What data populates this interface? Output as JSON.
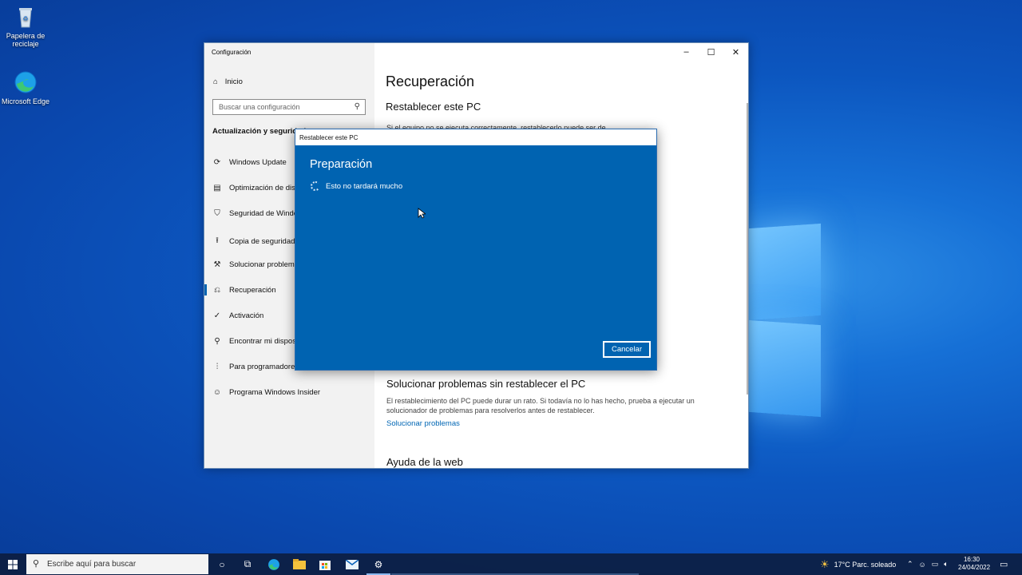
{
  "desktop": {
    "icons": [
      {
        "label": "Papelera de reciclaje"
      },
      {
        "label": "Microsoft Edge"
      }
    ]
  },
  "settings": {
    "window_title": "Configuración",
    "home_label": "Inicio",
    "search_placeholder": "Buscar una configuración",
    "section_heading": "Actualización y seguridad",
    "nav": [
      {
        "label": "Windows Update",
        "icon": "sync-icon"
      },
      {
        "label": "Optimización de distribución",
        "icon": "delivery-icon"
      },
      {
        "label": "Seguridad de Windows",
        "icon": "shield-icon"
      },
      {
        "label": "Copia de seguridad",
        "icon": "backup-arrow-icon"
      },
      {
        "label": "Solucionar problemas",
        "icon": "wrench-icon"
      },
      {
        "label": "Recuperación",
        "icon": "recovery-icon"
      },
      {
        "label": "Activación",
        "icon": "check-circle-icon"
      },
      {
        "label": "Encontrar mi dispositivo",
        "icon": "person-pin-icon"
      },
      {
        "label": "Para programadores",
        "icon": "sliders-icon"
      },
      {
        "label": "Programa Windows Insider",
        "icon": "insider-icon"
      }
    ],
    "active_item": "Recuperación",
    "page_title": "Recuperación",
    "reset_title": "Restablecer este PC",
    "reset_text_partial": "Si el equipo no se ejecuta correctamente, restablecerlo puede ser de",
    "trouble_title": "Solucionar problemas sin restablecer el PC",
    "trouble_desc": "El restablecimiento del PC puede durar un rato. Si todavía no lo has hecho, prueba a ejecutar un solucionador de problemas para resolverlos antes de restablecer.",
    "trouble_link": "Solucionar problemas",
    "web_help_title": "Ayuda de la web"
  },
  "dialog": {
    "title": "Restablecer este PC",
    "heading": "Preparación",
    "message": "Esto no tardará mucho",
    "cancel_label": "Cancelar"
  },
  "taskbar": {
    "search_placeholder": "Escribe aquí para buscar",
    "weather": "17°C  Parc. soleado",
    "time": "16:30",
    "date": "24/04/2022"
  },
  "colors": {
    "accent": "#0063b1",
    "link": "#0066b4"
  }
}
